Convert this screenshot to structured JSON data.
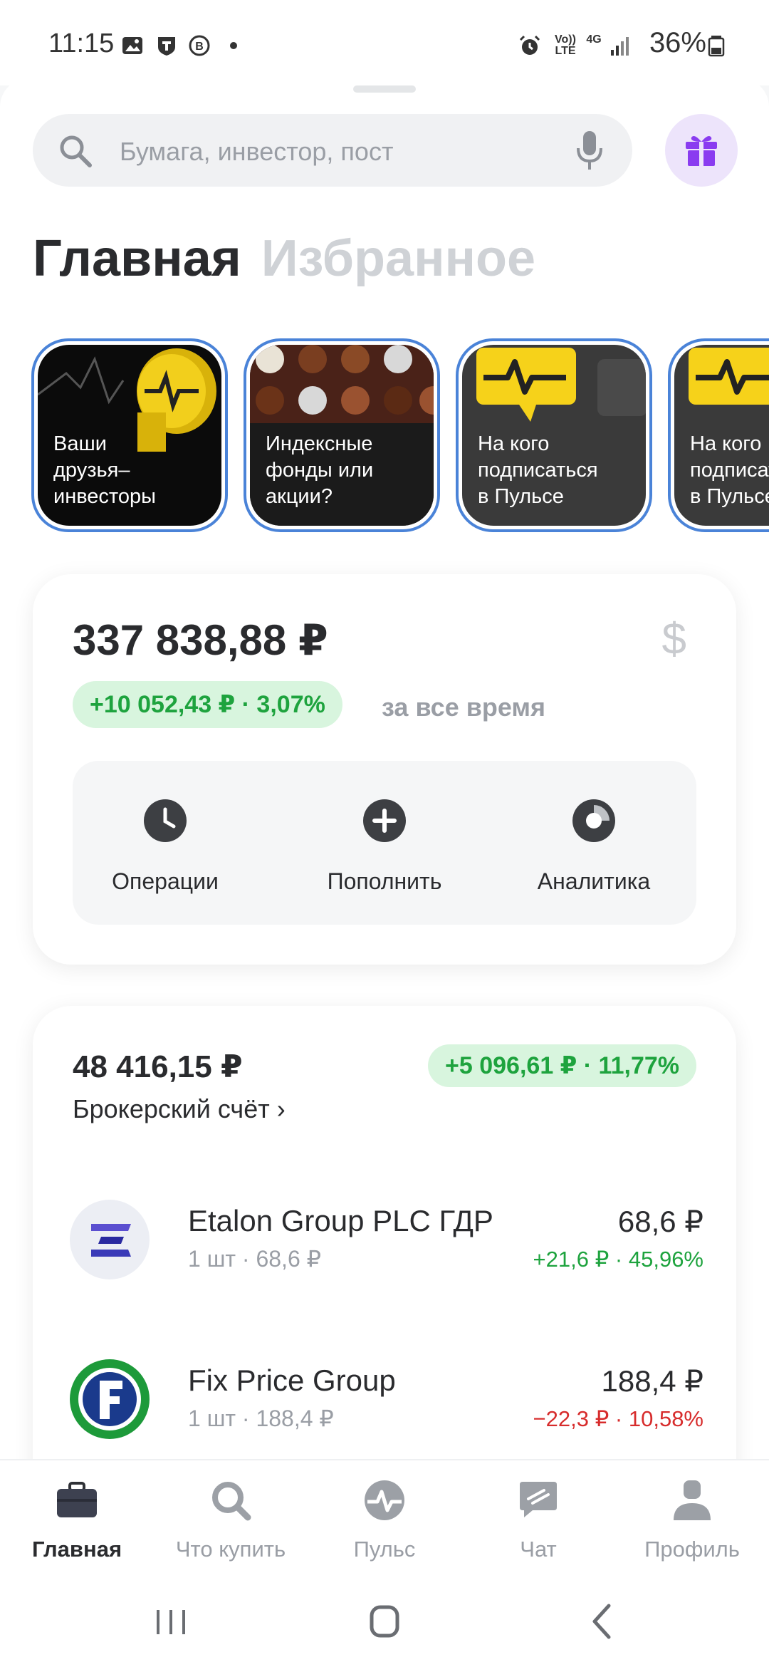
{
  "status_bar": {
    "time": "11:15",
    "network_volte": "Vo)) LTE",
    "network_4g": "4G",
    "battery": "36%",
    "icons": [
      "image-icon",
      "t-app-icon",
      "vk-icon",
      "dot-icon",
      "alarm-icon",
      "signal-icon",
      "battery-icon"
    ]
  },
  "search": {
    "placeholder": "Бумага, инвестор, пост",
    "icon": "search-icon",
    "mic_icon": "mic-icon"
  },
  "gift_icon": "gift-icon",
  "header_tabs": {
    "active": "Главная",
    "inactive": "Избранное"
  },
  "stories": [
    {
      "label": "Ваши\nдрузья–\nинвесторы"
    },
    {
      "label": "Индексные\nфонды или\nакции?"
    },
    {
      "label": "На кого\nподписаться\nв Пульсе"
    },
    {
      "label": "На кого\nподписаться\nв Пульсе"
    }
  ],
  "portfolio": {
    "total": "337 838,88 ₽",
    "currency_icon": "$",
    "change": "+10 052,43 ₽ · 3,07%",
    "period": "за все время",
    "actions": [
      {
        "label": "Операции",
        "icon": "clock-icon"
      },
      {
        "label": "Пополнить",
        "icon": "plus-icon"
      },
      {
        "label": "Аналитика",
        "icon": "pie-icon"
      }
    ]
  },
  "broker": {
    "value": "48 416,15 ₽",
    "change": "+5 096,61 ₽ · 11,77%",
    "name": "Брокерский счёт ›",
    "assets": [
      {
        "name": "Etalon Group PLC ГДР",
        "sub": "1 шт · 68,6 ₽",
        "price": "68,6 ₽",
        "change": "+21,6 ₽ · 45,96%",
        "trend": "up"
      },
      {
        "name": "Fix Price Group",
        "sub": "1 шт · 188,4 ₽",
        "price": "188,4 ₽",
        "change": "−22,3 ₽ · 10,58%",
        "trend": "down"
      }
    ]
  },
  "bottom_tabs": [
    {
      "label": "Главная",
      "icon": "briefcase-icon",
      "active": true
    },
    {
      "label": "Что купить",
      "icon": "search-icon",
      "active": false
    },
    {
      "label": "Пульс",
      "icon": "pulse-icon",
      "active": false
    },
    {
      "label": "Чат",
      "icon": "chat-icon",
      "active": false
    },
    {
      "label": "Профиль",
      "icon": "profile-icon",
      "active": false
    }
  ],
  "colors": {
    "positive": "#1ea33e",
    "negative": "#d72c2c",
    "positive_bg": "#d8f5de",
    "story_border": "#4a83d8",
    "gift_bg": "#ede4fb",
    "gift": "#8a3cf0"
  }
}
